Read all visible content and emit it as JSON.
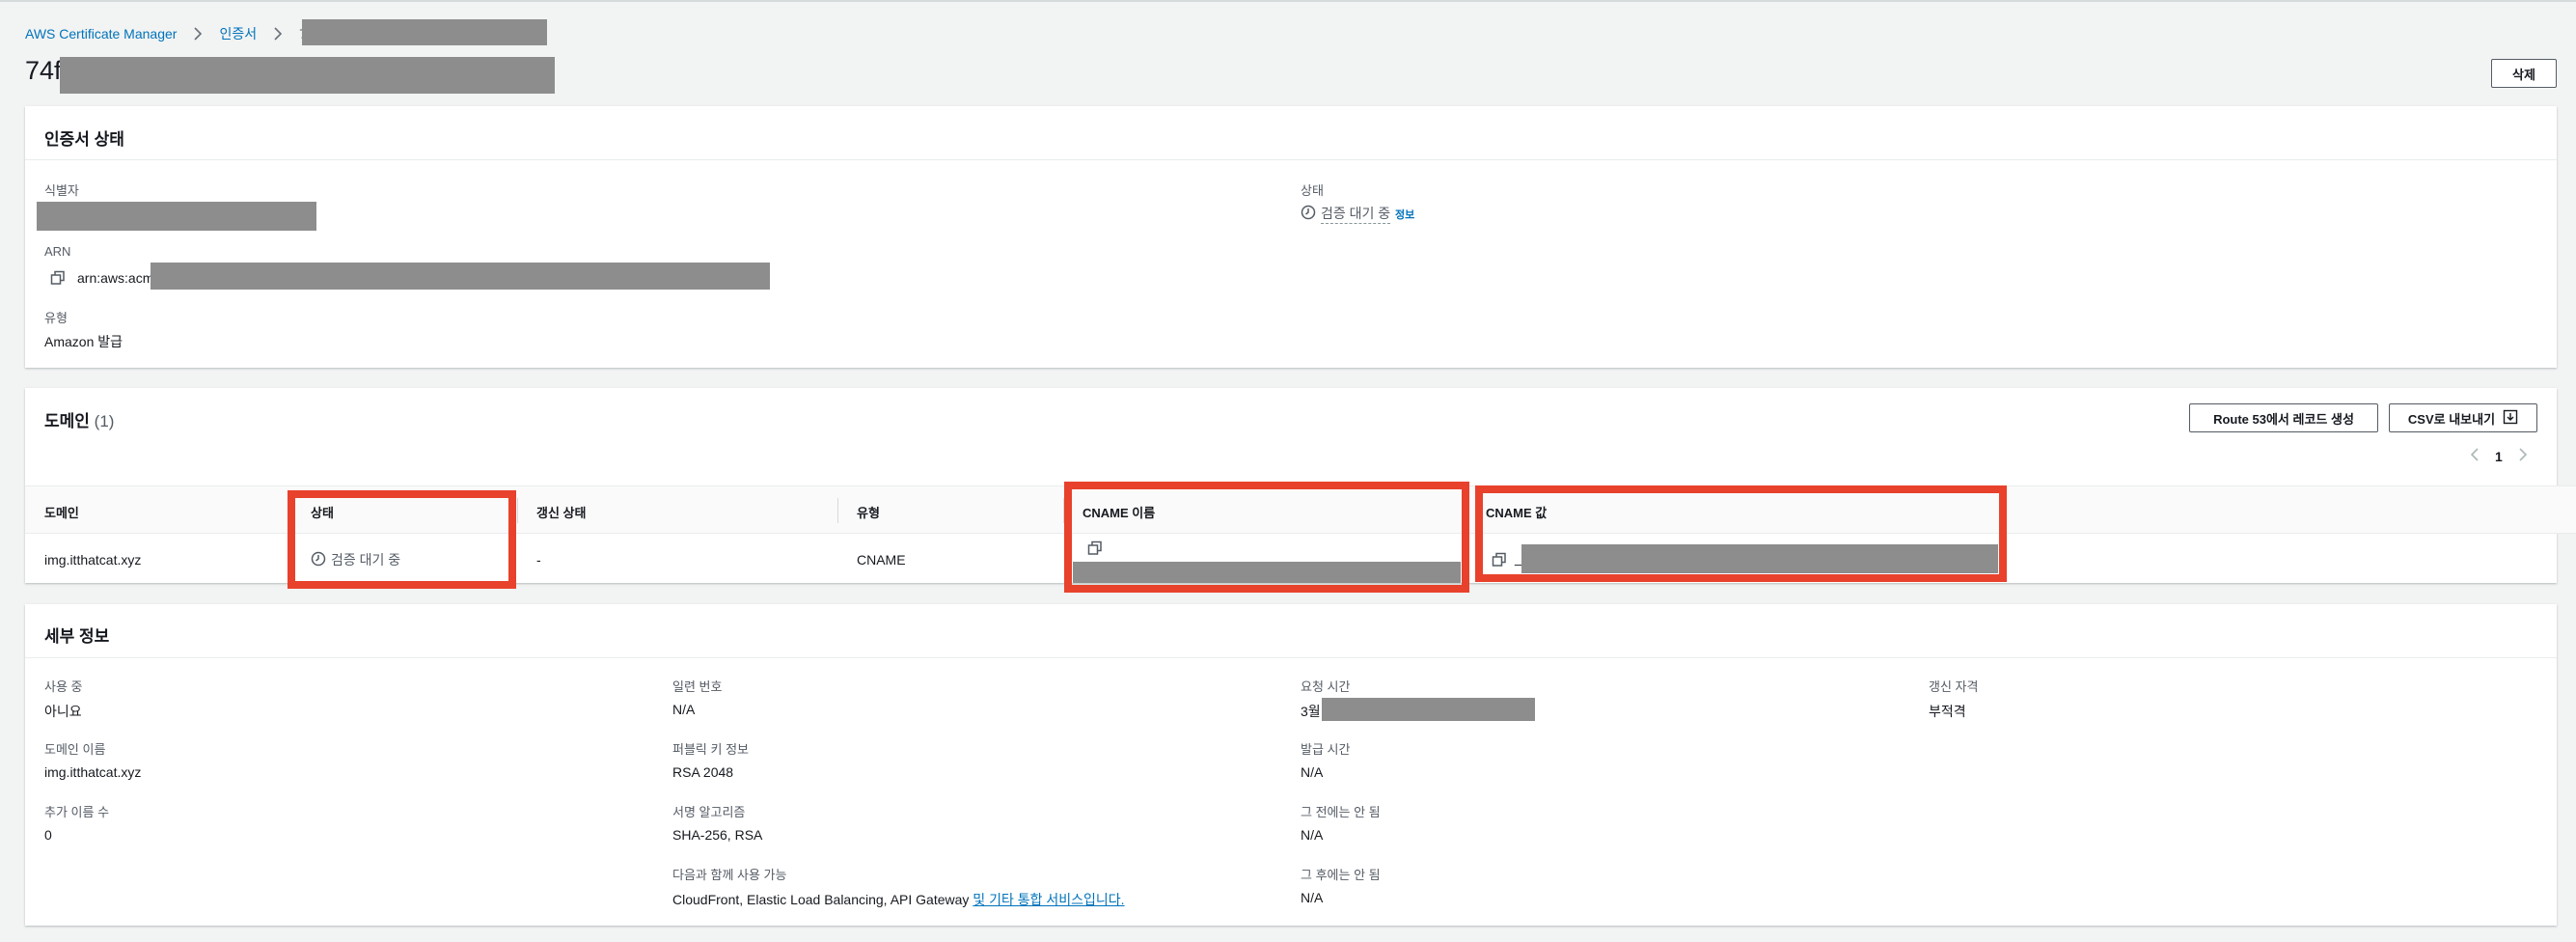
{
  "breadcrumb": {
    "items": [
      "AWS Certificate Manager",
      "인증서",
      "74f"
    ]
  },
  "page_title": "74f",
  "delete_label": "삭제",
  "cert_status": {
    "title": "인증서 상태",
    "identifier_label": "식별자",
    "arn_label": "ARN",
    "arn_value": "arn:aws:acm",
    "type_label": "유형",
    "type_value": "Amazon 발급",
    "status_label": "상태",
    "status_value": "검증 대기 중",
    "info_label": "정보"
  },
  "domains": {
    "title": "도메인",
    "count": "(1)",
    "route53_button": "Route 53에서 레코드 생성",
    "csv_button": "CSV로 내보내기",
    "page_number": "1",
    "columns": [
      "도메인",
      "상태",
      "갱신 상태",
      "유형",
      "CNAME 이름",
      "CNAME 값"
    ],
    "rows": [
      {
        "domain": "img.itthatcat.xyz",
        "status": "검증 대기 중",
        "renewal": "-",
        "type": "CNAME",
        "cname_value_prefix": "_"
      }
    ]
  },
  "details": {
    "title": "세부 정보",
    "in_use_label": "사용 중",
    "in_use_value": "아니요",
    "domain_name_label": "도메인 이름",
    "domain_name_value": "img.itthatcat.xyz",
    "additional_names_label": "추가 이름 수",
    "additional_names_value": "0",
    "serial_label": "일련 번호",
    "serial_value": "N/A",
    "public_key_label": "퍼블릭 키 정보",
    "public_key_value": "RSA 2048",
    "signature_label": "서명 알고리즘",
    "signature_value": "SHA-256, RSA",
    "usable_with_label": "다음과 함께 사용 가능",
    "usable_with_value": "CloudFront, Elastic Load Balancing, API Gateway",
    "usable_with_link": "및 기타 통합 서비스입니다.",
    "requested_label": "요청 시간",
    "requested_value": "3월",
    "issued_label": "발급 시간",
    "issued_value": "N/A",
    "not_before_label": "그 전에는 안 됨",
    "not_before_value": "N/A",
    "not_after_label": "그 후에는 안 됨",
    "not_after_value": "N/A",
    "renewal_eligibility_label": "갱신 자격",
    "renewal_eligibility_value": "부적격"
  },
  "colors": {
    "highlight": "#e8412c",
    "link": "#0073bb",
    "redaction": "#8d8d8d"
  }
}
